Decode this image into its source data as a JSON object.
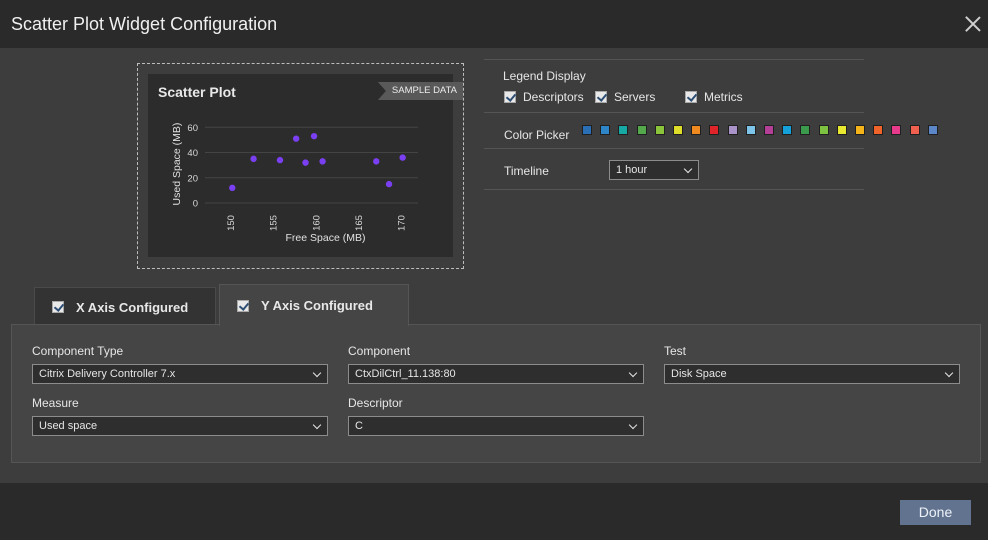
{
  "window": {
    "title": "Scatter Plot Widget Configuration",
    "close_icon": "close-icon"
  },
  "preview": {
    "card_title": "Scatter Plot",
    "sample_label": "SAMPLE DATA"
  },
  "chart_data": {
    "type": "scatter",
    "title": "Scatter Plot",
    "xlabel": "Free Space (MB)",
    "ylabel": "Used Space (MB)",
    "xlim": [
      147,
      172
    ],
    "ylim": [
      0,
      65
    ],
    "xticks": [
      150,
      155,
      160,
      165,
      170
    ],
    "yticks": [
      0,
      20,
      40,
      60
    ],
    "grid": true,
    "point_color": "#7b3ff2",
    "points": [
      {
        "x": 150.2,
        "y": 12
      },
      {
        "x": 152.7,
        "y": 35
      },
      {
        "x": 155.8,
        "y": 34
      },
      {
        "x": 157.7,
        "y": 51
      },
      {
        "x": 158.8,
        "y": 32
      },
      {
        "x": 159.8,
        "y": 53
      },
      {
        "x": 160.8,
        "y": 33
      },
      {
        "x": 167.1,
        "y": 33
      },
      {
        "x": 168.6,
        "y": 15
      },
      {
        "x": 170.2,
        "y": 36
      }
    ]
  },
  "legend_display": {
    "label": "Legend Display",
    "options": [
      {
        "label": "Descriptors",
        "checked": true
      },
      {
        "label": "Servers",
        "checked": true
      },
      {
        "label": "Metrics",
        "checked": true
      }
    ]
  },
  "color_picker": {
    "label": "Color Picker",
    "colors": [
      "#2a6fb3",
      "#2e86c9",
      "#17a9a3",
      "#52a84a",
      "#8cc43c",
      "#dede2a",
      "#f08a1e",
      "#e0242a",
      "#a993c8",
      "#7ec4e8",
      "#b34096",
      "#14a0d8",
      "#3c9a4c",
      "#7ec242",
      "#e8e830",
      "#f5b41a",
      "#f0642a",
      "#e83a8c",
      "#f0604e",
      "#5b87c9"
    ]
  },
  "timeline": {
    "label": "Timeline",
    "value": "1 hour"
  },
  "tabs": [
    {
      "label": "X Axis Configured",
      "checked": true
    },
    {
      "label": "Y Axis Configured",
      "checked": true
    }
  ],
  "form": {
    "component_type": {
      "label": "Component Type",
      "value": "Citrix Delivery Controller 7.x"
    },
    "component": {
      "label": "Component",
      "value": "CtxDilCtrl_11.138:80"
    },
    "test": {
      "label": "Test",
      "value": "Disk Space"
    },
    "measure": {
      "label": "Measure",
      "value": "Used space"
    },
    "descriptor": {
      "label": "Descriptor",
      "value": "C"
    }
  },
  "footer": {
    "done_label": "Done"
  }
}
